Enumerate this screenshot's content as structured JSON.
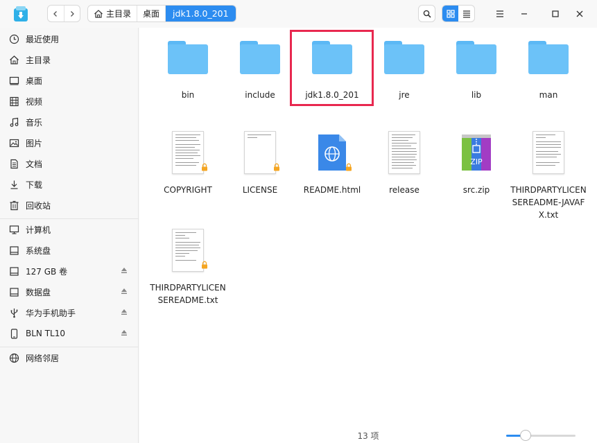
{
  "navigation": {
    "back_icon": "chevron-left-icon",
    "forward_icon": "chevron-right-icon"
  },
  "breadcrumb": [
    {
      "label": "主目录",
      "icon": "home-icon"
    },
    {
      "label": "桌面"
    },
    {
      "label": "jdk1.8.0_201",
      "active": true
    }
  ],
  "sidebar": {
    "items": [
      {
        "label": "最近使用",
        "icon": "clock-icon"
      },
      {
        "label": "主目录",
        "icon": "home-icon"
      },
      {
        "label": "桌面",
        "icon": "desktop-icon"
      },
      {
        "label": "视频",
        "icon": "video-icon"
      },
      {
        "label": "音乐",
        "icon": "music-icon"
      },
      {
        "label": "图片",
        "icon": "picture-icon"
      },
      {
        "label": "文档",
        "icon": "document-icon"
      },
      {
        "label": "下载",
        "icon": "download-icon"
      },
      {
        "label": "回收站",
        "icon": "trash-icon"
      },
      {
        "label": "计算机",
        "icon": "computer-icon"
      },
      {
        "label": "系统盘",
        "icon": "disk-icon"
      },
      {
        "label": "127 GB 卷",
        "icon": "disk-icon",
        "eject": true
      },
      {
        "label": "数据盘",
        "icon": "disk-icon",
        "eject": true
      },
      {
        "label": "华为手机助手",
        "icon": "usb-icon",
        "eject": true
      },
      {
        "label": "BLN TL10",
        "icon": "phone-icon",
        "eject": true
      },
      {
        "label": "网络邻居",
        "icon": "network-icon"
      }
    ]
  },
  "files": [
    {
      "name": "bin",
      "type": "folder"
    },
    {
      "name": "include",
      "type": "folder"
    },
    {
      "name": "jdk1.8.0_201",
      "type": "folder",
      "highlighted": true
    },
    {
      "name": "jre",
      "type": "folder"
    },
    {
      "name": "lib",
      "type": "folder"
    },
    {
      "name": "man",
      "type": "folder"
    },
    {
      "name": "COPYRIGHT",
      "type": "document",
      "locked": true
    },
    {
      "name": "LICENSE",
      "type": "document",
      "locked": true
    },
    {
      "name": "README.html",
      "type": "html",
      "locked": true
    },
    {
      "name": "release",
      "type": "document",
      "locked": false
    },
    {
      "name": "src.zip",
      "type": "zip",
      "locked": false
    },
    {
      "name": "THIRDPARTYLICENSEREADME-JAVAFX.txt",
      "type": "document",
      "locked": false
    },
    {
      "name": "THIRDPARTYLICENSEREADME.txt",
      "type": "document",
      "locked": true
    }
  ],
  "status": {
    "item_count": "13 项",
    "zoom_fraction": 0.28
  },
  "colors": {
    "accent": "#2c8cf0",
    "folder": "#6cc2f8",
    "highlight": "#e8284f",
    "lock": "#f5a623"
  }
}
